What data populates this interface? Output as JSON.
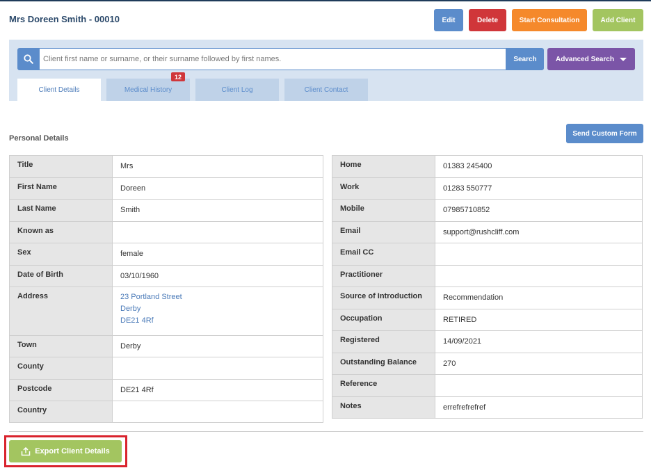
{
  "client": {
    "title": "Mrs Doreen Smith - 00010"
  },
  "actions": {
    "edit": "Edit",
    "delete": "Delete",
    "start_consultation": "Start Consultation",
    "add_client": "Add Client"
  },
  "search": {
    "placeholder": "Client first name or surname, or their surname followed by first names.",
    "button": "Search",
    "advanced": "Advanced Search"
  },
  "tabs": [
    {
      "label": "Client Details",
      "active": true
    },
    {
      "label": "Medical History",
      "badge": "12"
    },
    {
      "label": "Client Log"
    },
    {
      "label": "Client Contact"
    }
  ],
  "section": {
    "title": "Personal Details",
    "custom_form": "Send Custom Form"
  },
  "left_table": [
    {
      "label": "Title",
      "value": "Mrs"
    },
    {
      "label": "First Name",
      "value": "Doreen"
    },
    {
      "label": "Last Name",
      "value": "Smith"
    },
    {
      "label": "Known as",
      "value": ""
    },
    {
      "label": "Sex",
      "value": "female"
    },
    {
      "label": "Date of Birth",
      "value": "03/10/1960"
    },
    {
      "label": "Address",
      "lines": [
        "23 Portland Street",
        "Derby",
        "DE21 4Rf"
      ]
    },
    {
      "label": "Town",
      "value": "Derby"
    },
    {
      "label": "County",
      "value": ""
    },
    {
      "label": "Postcode",
      "value": "DE21 4Rf"
    },
    {
      "label": "Country",
      "value": ""
    }
  ],
  "right_table": [
    {
      "label": "Home",
      "value": "01383 245400"
    },
    {
      "label": "Work",
      "value": "01283 550777"
    },
    {
      "label": "Mobile",
      "value": "07985710852"
    },
    {
      "label": "Email",
      "value": "support@rushcliff.com"
    },
    {
      "label": "Email CC",
      "value": ""
    },
    {
      "label": "Practitioner",
      "value": ""
    },
    {
      "label": "Source of Introduction",
      "value": "Recommendation"
    },
    {
      "label": "Occupation",
      "value": "RETIRED"
    },
    {
      "label": "Registered",
      "value": "14/09/2021"
    },
    {
      "label": "Outstanding Balance",
      "value": "270"
    },
    {
      "label": "Reference",
      "value": ""
    },
    {
      "label": "Notes",
      "value": "errefrefrefref"
    }
  ],
  "export": {
    "label": "Export Client Details"
  },
  "colors": {
    "primary": "#5b8ccb",
    "danger": "#d0363a",
    "warning": "#f5892b",
    "success": "#a3c560",
    "purple": "#7b55a7",
    "highlight": "#d9232d"
  },
  "icons": {
    "search": "search-icon",
    "advanced_caret": "caret-down-icon",
    "export": "upload-icon"
  }
}
